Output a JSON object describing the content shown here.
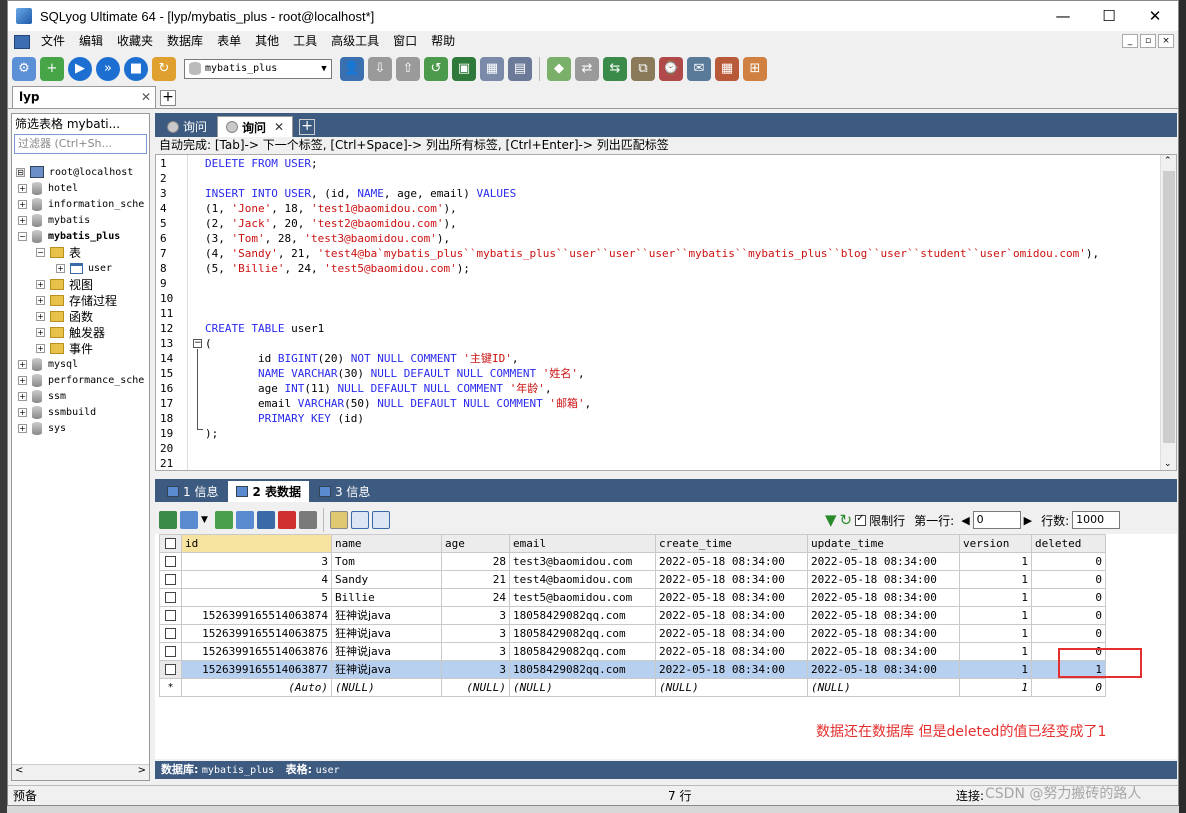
{
  "window": {
    "title": "SQLyog Ultimate 64 - [lyp/mybatis_plus - root@localhost*]",
    "min": "—",
    "max": "☐",
    "close": "✕"
  },
  "menu": [
    "文件",
    "编辑",
    "收藏夹",
    "数据库",
    "表单",
    "其他",
    "工具",
    "高级工具",
    "窗口",
    "帮助"
  ],
  "toolbar": {
    "db_select": "mybatis_plus"
  },
  "connection_tab": {
    "label": "lyp",
    "close": "✕"
  },
  "sidebar": {
    "filter_label": "筛选表格 mybati...",
    "filter_placeholder": "过滤器 (Ctrl+Sh...",
    "tree": [
      {
        "label": "root@localhost",
        "type": "server",
        "exp": "⊟",
        "level": 0
      },
      {
        "label": "hotel",
        "type": "db",
        "exp": "+",
        "level": 1
      },
      {
        "label": "information_sche",
        "type": "db",
        "exp": "+",
        "level": 1
      },
      {
        "label": "mybatis",
        "type": "db",
        "exp": "+",
        "level": 1
      },
      {
        "label": "mybatis_plus",
        "type": "db",
        "exp": "−",
        "level": 1,
        "bold": true
      },
      {
        "label": "表",
        "type": "folder",
        "exp": "−",
        "level": 2
      },
      {
        "label": "user",
        "type": "table",
        "exp": "+",
        "level": 3
      },
      {
        "label": "视图",
        "type": "folder",
        "exp": "+",
        "level": 2
      },
      {
        "label": "存储过程",
        "type": "folder",
        "exp": "+",
        "level": 2
      },
      {
        "label": "函数",
        "type": "folder",
        "exp": "+",
        "level": 2
      },
      {
        "label": "触发器",
        "type": "folder",
        "exp": "+",
        "level": 2
      },
      {
        "label": "事件",
        "type": "folder",
        "exp": "+",
        "level": 2
      },
      {
        "label": "mysql",
        "type": "db",
        "exp": "+",
        "level": 1
      },
      {
        "label": "performance_sche",
        "type": "db",
        "exp": "+",
        "level": 1
      },
      {
        "label": "ssm",
        "type": "db",
        "exp": "+",
        "level": 1
      },
      {
        "label": "ssmbuild",
        "type": "db",
        "exp": "+",
        "level": 1
      },
      {
        "label": "sys",
        "type": "db",
        "exp": "+",
        "level": 1
      }
    ]
  },
  "query_tabs": [
    {
      "label": "询问",
      "active": false
    },
    {
      "label": "询问",
      "active": true
    }
  ],
  "autocomplete_hint": "自动完成: [Tab]-> 下一个标签, [Ctrl+Space]-> 列出所有标签, [Ctrl+Enter]-> 列出匹配标签",
  "editor_lines": [
    [
      [
        "kw",
        "DELETE FROM USER"
      ],
      [
        "",
        "; "
      ]
    ],
    [],
    [
      [
        "kw",
        "INSERT INTO USER"
      ],
      [
        "",
        ", (id, "
      ],
      [
        "kw",
        "NAME"
      ],
      [
        "",
        ", age, email) "
      ],
      [
        "kw",
        "VALUES"
      ]
    ],
    [
      [
        "",
        "(1, "
      ],
      [
        "str",
        "'Jone'"
      ],
      [
        "",
        ", 18, "
      ],
      [
        "str",
        "'test1@baomidou.com'"
      ],
      [
        "",
        "),"
      ]
    ],
    [
      [
        "",
        "(2, "
      ],
      [
        "str",
        "'Jack'"
      ],
      [
        "",
        ", 20, "
      ],
      [
        "str",
        "'test2@baomidou.com'"
      ],
      [
        "",
        "),"
      ]
    ],
    [
      [
        "",
        "(3, "
      ],
      [
        "str",
        "'Tom'"
      ],
      [
        "",
        ", 28, "
      ],
      [
        "str",
        "'test3@baomidou.com'"
      ],
      [
        "",
        "),"
      ]
    ],
    [
      [
        "",
        "(4, "
      ],
      [
        "str",
        "'Sandy'"
      ],
      [
        "",
        ", 21, "
      ],
      [
        "str",
        "'test4@ba`mybatis_plus``mybatis_plus``user``user``user``mybatis``mybatis_plus``blog``user``student``user`omidou.com'"
      ],
      [
        "",
        "),"
      ]
    ],
    [
      [
        "",
        "(5, "
      ],
      [
        "str",
        "'Billie'"
      ],
      [
        "",
        ", 24, "
      ],
      [
        "str",
        "'test5@baomidou.com'"
      ],
      [
        "",
        ");"
      ]
    ],
    [],
    [],
    [],
    [
      [
        "kw",
        "CREATE TABLE"
      ],
      [
        "",
        " user1"
      ]
    ],
    [
      [
        "",
        "("
      ]
    ],
    [
      [
        "",
        "        id "
      ],
      [
        "kw",
        "BIGINT"
      ],
      [
        "",
        "(20) "
      ],
      [
        "kw",
        "NOT NULL COMMENT"
      ],
      [
        "",
        " "
      ],
      [
        "str",
        "'主键ID'"
      ],
      [
        "",
        ","
      ]
    ],
    [
      [
        "",
        "        "
      ],
      [
        "kw",
        "NAME VARCHAR"
      ],
      [
        "",
        "(30) "
      ],
      [
        "kw",
        "NULL DEFAULT NULL COMMENT"
      ],
      [
        "",
        " "
      ],
      [
        "str",
        "'姓名'"
      ],
      [
        "",
        ","
      ]
    ],
    [
      [
        "",
        "        age "
      ],
      [
        "kw",
        "INT"
      ],
      [
        "",
        "(11) "
      ],
      [
        "kw",
        "NULL DEFAULT NULL COMMENT"
      ],
      [
        "",
        " "
      ],
      [
        "str",
        "'年龄'"
      ],
      [
        "",
        ","
      ]
    ],
    [
      [
        "",
        "        email "
      ],
      [
        "kw",
        "VARCHAR"
      ],
      [
        "",
        "(50) "
      ],
      [
        "kw",
        "NULL DEFAULT NULL COMMENT"
      ],
      [
        "",
        " "
      ],
      [
        "str",
        "'邮箱'"
      ],
      [
        "",
        ","
      ]
    ],
    [
      [
        "",
        "        "
      ],
      [
        "kw",
        "PRIMARY KEY"
      ],
      [
        "",
        " (id)"
      ]
    ],
    [
      [
        "",
        ");"
      ]
    ],
    [],
    []
  ],
  "result_tabs": [
    {
      "label": "1 信息",
      "active": false
    },
    {
      "label": "2 表数据",
      "active": true
    },
    {
      "label": "3 信息",
      "active": false
    }
  ],
  "result_toolbar": {
    "limit_label": "限制行",
    "first_row_label": "第一行:",
    "first_row": "0",
    "rows_label": "行数:",
    "rows": "1000"
  },
  "grid": {
    "columns": [
      "id",
      "name",
      "age",
      "email",
      "create_time",
      "update_time",
      "version",
      "deleted"
    ],
    "rows": [
      [
        "3",
        "Tom",
        "28",
        "test3@baomidou.com",
        "2022-05-18 08:34:00",
        "2022-05-18 08:34:00",
        "1",
        "0"
      ],
      [
        "4",
        "Sandy",
        "21",
        "test4@baomidou.com",
        "2022-05-18 08:34:00",
        "2022-05-18 08:34:00",
        "1",
        "0"
      ],
      [
        "5",
        "Billie",
        "24",
        "test5@baomidou.com",
        "2022-05-18 08:34:00",
        "2022-05-18 08:34:00",
        "1",
        "0"
      ],
      [
        "1526399165514063874",
        "狂神说java",
        "3",
        "18058429082qq.com",
        "2022-05-18 08:34:00",
        "2022-05-18 08:34:00",
        "1",
        "0"
      ],
      [
        "1526399165514063875",
        "狂神说java",
        "3",
        "18058429082qq.com",
        "2022-05-18 08:34:00",
        "2022-05-18 08:34:00",
        "1",
        "0"
      ],
      [
        "1526399165514063876",
        "狂神说java",
        "3",
        "18058429082qq.com",
        "2022-05-18 08:34:00",
        "2022-05-18 08:34:00",
        "1",
        "0"
      ],
      [
        "1526399165514063877",
        "狂神说java",
        "3",
        "18058429082qq.com",
        "2022-05-18 08:34:00",
        "2022-05-18 08:34:00",
        "1",
        "1"
      ]
    ],
    "new_row": [
      "(Auto)",
      "(NULL)",
      "(NULL)",
      "(NULL)",
      "(NULL)",
      "(NULL)",
      "1",
      "0"
    ],
    "new_row_marker": "*",
    "selected_index": 6
  },
  "annotation": "数据还在数据库 但是deleted的值已经变成了1",
  "db_info": {
    "db_label": "数据库:",
    "db": "mybatis_plus",
    "table_label": "表格:",
    "table": "user"
  },
  "status": {
    "left": "预备",
    "middle": "7 行",
    "right": "连接:"
  },
  "watermark": "CSDN @努力搬砖的路人"
}
